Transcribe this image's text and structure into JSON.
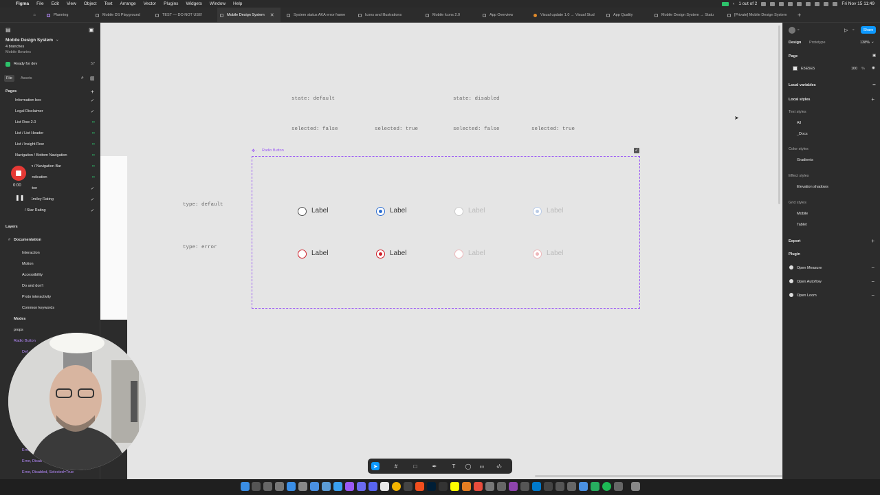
{
  "menubar": {
    "app": "Figma",
    "items": [
      "File",
      "Edit",
      "View",
      "Object",
      "Text",
      "Arrange",
      "Vector",
      "Plugins",
      "Widgets",
      "Window",
      "Help"
    ],
    "status": "1 out of 2",
    "datetime": "Fri Nov 15  11:49"
  },
  "tabs": [
    {
      "label": "Planning"
    },
    {
      "label": "Mobile DS Playground"
    },
    {
      "label": "TEST — DO NOT USE!"
    },
    {
      "label": "Mobile Design System"
    },
    {
      "label": "System status AKA error frame"
    },
    {
      "label": "Icons and Illustrations"
    },
    {
      "label": "Mobile Icons 2.0"
    },
    {
      "label": "App Overview"
    },
    {
      "label": "Visual update 1.0 → Visual Stud"
    },
    {
      "label": "App Quality"
    },
    {
      "label": "Mobile Design System → Statu"
    },
    {
      "label": "[Private] Mobile Design System"
    }
  ],
  "left": {
    "file_title": "Mobile Design System",
    "branches": "4 branches",
    "library": "Mobile libraries",
    "ready": "Ready for dev",
    "ready_count": "57",
    "tab_file": "File",
    "tab_assets": "Assets",
    "pages_heading": "Pages",
    "pages": [
      "Information box",
      "Legal Disclaimer",
      "List Row 2.0",
      "List / List Header",
      "List / Insight Row",
      "Navigation / Bottom Navigation",
      "ion / Navigation Bar",
      "Indication",
      "tton",
      "Smiley Rating",
      "/ Star Rating"
    ],
    "recorder_time": "0:00",
    "layers_heading": "Layers",
    "layers": [
      "Documentation",
      "Interaction",
      "Motion",
      "Accessibility",
      "Do and don't",
      "Proto interactivity",
      "Common keywords",
      "Modes",
      "props",
      "Radio Button",
      "Def"
    ],
    "bottom_layers": [
      "Error",
      "Error, Disab",
      "Error, Disabled, Selected=True"
    ]
  },
  "canvas": {
    "state_default": "state: default",
    "state_disabled": "state: disabled",
    "sel1": "selected: false",
    "sel2": "selected: true",
    "sel3": "selected: false",
    "sel4": "selected: true",
    "component_name": "Radio Button",
    "type_default": "type: default",
    "type_error": "type: error",
    "radio_label": "Label"
  },
  "right": {
    "tab_design": "Design",
    "tab_prototype": "Prototype",
    "zoom": "138%",
    "share": "Share",
    "page_heading": "Page",
    "page_color": "E5E5E5",
    "page_opacity": "100",
    "percent": "%",
    "local_variables": "Local variables",
    "local_styles": "Local styles",
    "text_styles": "Text styles",
    "text_items": [
      "All",
      "_Docs"
    ],
    "color_styles": "Color styles",
    "color_items": [
      "Gradients"
    ],
    "effect_styles": "Effect styles",
    "effect_items": [
      "Elevation shadows"
    ],
    "grid_styles": "Grid styles",
    "grid_items": [
      "Mobile",
      "Tablet"
    ],
    "export": "Export",
    "plugin": "Plugin",
    "plugins": [
      "Open Measure",
      "Open Autoflow",
      "Open Loom"
    ]
  },
  "colors": {
    "selection": "#9b59f5",
    "blue_dot": "#2f6fd1",
    "red_dot": "#d0202a",
    "accent": "#0d99ff"
  }
}
